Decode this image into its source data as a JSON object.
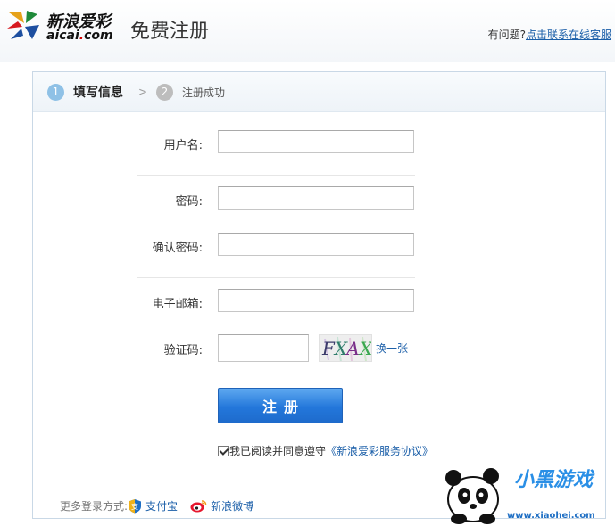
{
  "header": {
    "logo_cn": "新浪爱彩",
    "logo_en": "aicai",
    "logo_en_dot": ".",
    "logo_en_tld": "com",
    "page_title": "免费注册",
    "help_prefix": "有问题?",
    "help_link": "点击联系在线客服"
  },
  "steps": [
    {
      "num": "1",
      "label": "填写信息",
      "state": "active"
    },
    {
      "num": "2",
      "label": "注册成功",
      "state": "inactive"
    }
  ],
  "step_separator": ">",
  "form": {
    "username_label": "用户名:",
    "username_value": "",
    "password_label": "密码:",
    "password_value": "",
    "confirm_label": "确认密码:",
    "confirm_value": "",
    "email_label": "电子邮箱:",
    "email_value": "",
    "captcha_label": "验证码:",
    "captcha_value": "",
    "captcha_image_text": [
      "F",
      "X",
      "A",
      "X"
    ],
    "refresh_label": "换一张",
    "submit_label": "注册"
  },
  "agreement": {
    "checked": true,
    "text": "我已阅读并同意遵守",
    "link": "《新浪爱彩服务协议》"
  },
  "more_login": {
    "label": "更多登录方式:",
    "options": [
      {
        "name": "支付宝",
        "icon": "alipay-icon"
      },
      {
        "name": "新浪微博",
        "icon": "weibo-icon"
      }
    ]
  },
  "watermark": {
    "text": "小黑游戏",
    "url": "www.xiaohei.com"
  },
  "colors": {
    "link": "#1a5ea8",
    "button": "#2377db",
    "step_active": "#8fc1e6",
    "step_inactive": "#bdbdbd",
    "panel_border": "#c9d8e6"
  }
}
